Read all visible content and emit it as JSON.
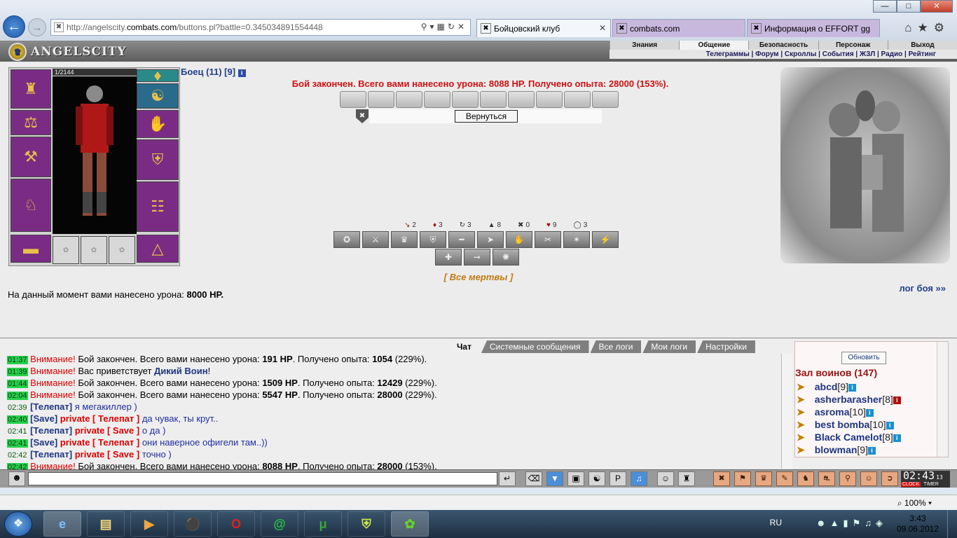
{
  "browser": {
    "url_prefix": "http://angelscity.",
    "url_domain": "combats.com",
    "url_suffix": "/buttons.pl?battle=0.345034891554448",
    "tabs": [
      {
        "label": "Бойцовский клуб"
      },
      {
        "label": "combats.com"
      },
      {
        "label": "Информация о EFFORT gg"
      }
    ]
  },
  "site": {
    "logo": "ANGELSCITY",
    "top_menu": [
      "Знания",
      "Общение",
      "Безопасность",
      "Персонаж",
      "Выход"
    ],
    "sub_menu": "Телеграммы | Форум | Скроллы | События | ЖЗЛ | Радио | Рейтинг"
  },
  "character": {
    "hp": "1/2144",
    "name": "Боец (11) [9]",
    "info_icon": "i"
  },
  "battle": {
    "result": "Бой закончен. Всего вами нанесено урона: 8088 HP. Получено опыта: 28000 (153%).",
    "return_button": "Вернуться",
    "stats": [
      "2",
      "3",
      "3",
      "8",
      "0",
      "9",
      "3"
    ],
    "all_dead": "[ Все мертвы ]",
    "damage_now_label": "На данный момент вами нанесено урона:",
    "damage_now_value": "8000 HP.",
    "log_link": "лог боя »»"
  },
  "chat": {
    "tabs": [
      "Чат",
      "Системные сообщения",
      "Все логи",
      "Мои логи",
      "Настройки"
    ],
    "lines": [
      {
        "time": "01:37",
        "a": "Внимание!",
        "b": " Бой закончен. Всего вами нанесено урона: ",
        "c": "191 HP",
        "d": ". Получено опыта: ",
        "e": "1054",
        "f": " (229%)."
      },
      {
        "time": "01:39",
        "a": "Внимание!",
        "b": " Вас приветствует ",
        "c": "Дикий Воин",
        "d": "!",
        "e": "",
        "f": ""
      },
      {
        "time": "01:44",
        "a": "Внимание!",
        "b": " Бой закончен. Всего вами нанесено урона: ",
        "c": "1509 HP",
        "d": ". Получено опыта: ",
        "e": "12429",
        "f": " (229%)."
      },
      {
        "time": "02:04",
        "a": "Внимание!",
        "b": " Бой закончен. Всего вами нанесено урона: ",
        "c": "5547 HP",
        "d": ". Получено опыта: ",
        "e": "28000",
        "f": " (229%)."
      },
      {
        "time": "02:39",
        "p1": "[Телепат]",
        "p2": "",
        "msg": " я мегакиллер )"
      },
      {
        "time": "02:40",
        "p1": "[Save]",
        "p2": " private [ Телепат ]",
        "msg": " да чувак, ты крут.."
      },
      {
        "time": "02:41",
        "p1": "[Телепат]",
        "p2": " private [ Save ]",
        "msg": " о да )"
      },
      {
        "time": "02:41",
        "p1": "[Save]",
        "p2": " private [ Телепат ]",
        "msg": " они наверное офигели там..))"
      },
      {
        "time": "02:42",
        "p1": "[Телепат]",
        "p2": " private [ Save ]",
        "msg": " точно )"
      },
      {
        "time": "02:42",
        "a": "Внимание!",
        "b": " Бой закончен. Всего вами нанесено урона: ",
        "c": "8088 HP",
        "d": ". Получено опыта: ",
        "e": "28000",
        "f": " (153%)."
      }
    ]
  },
  "users": {
    "refresh": "Обновить",
    "title": "Зал воинов (147)",
    "list": [
      {
        "name": "abcd",
        "level": "[9]"
      },
      {
        "name": "asherbarasher",
        "level": "[8]"
      },
      {
        "name": "asroma",
        "level": "[10]"
      },
      {
        "name": "best bomba",
        "level": "[10]"
      },
      {
        "name": "Black Camelot",
        "level": "[8]"
      },
      {
        "name": "blowman",
        "level": "[9]"
      }
    ]
  },
  "clock": {
    "time": "02:43",
    "seconds": "13",
    "labels": [
      "CLOCK",
      "TIMER"
    ]
  },
  "status": {
    "zoom": "100%"
  },
  "taskbar": {
    "lang": "RU",
    "time": "3:43",
    "date": "09.06.2012"
  }
}
